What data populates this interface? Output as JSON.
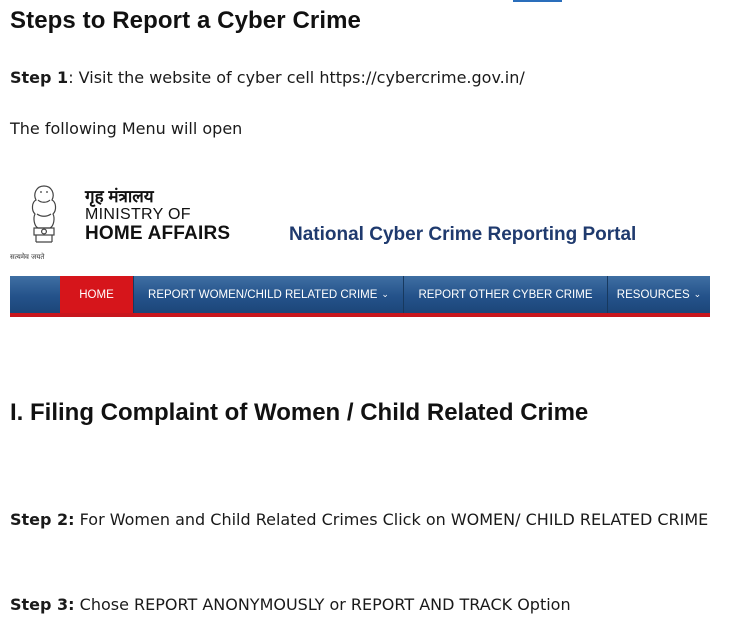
{
  "heading": "Steps to Report a Cyber Crime",
  "step1": {
    "label": "Step 1",
    "text": ": Visit the website of cyber cell https://cybercrime.gov.in/"
  },
  "menu_line": "The following Menu will open",
  "portal": {
    "emblem_caption": "सत्यमेव जयते",
    "ministry_hindi": "गृह मंत्रालय",
    "ministry_line1": "MINISTRY OF",
    "ministry_line2": "HOME AFFAIRS",
    "title": "National Cyber Crime Reporting Portal",
    "nav": {
      "home": "HOME",
      "women_child": "REPORT WOMEN/CHILD RELATED CRIME",
      "other": "REPORT OTHER CYBER CRIME",
      "resources": "RESOURCES",
      "chevron": "⌄"
    },
    "colors": {
      "nav_blue": "#24528a",
      "home_red": "#d6151b",
      "title_blue": "#1f3a6e"
    }
  },
  "section_heading": "I. Filing Complaint of Women / Child Related Crime",
  "step2": {
    "label": "Step 2:",
    "text": " For Women and Child Related Crimes Click on WOMEN/ CHILD RELATED CRIME"
  },
  "step3": {
    "label": "Step 3:",
    "text": " Chose REPORT ANONYMOUSLY or REPORT AND TRACK Option"
  }
}
